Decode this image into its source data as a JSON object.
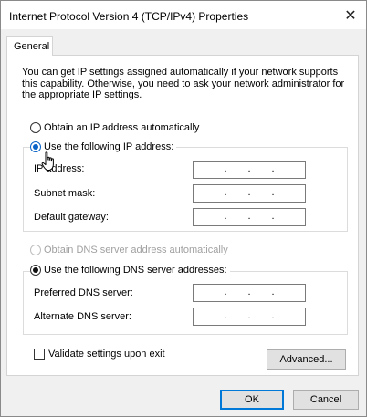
{
  "window": {
    "title": "Internet Protocol Version 4 (TCP/IPv4) Properties",
    "close_glyph": "✕"
  },
  "tabs": [
    {
      "label": "General",
      "selected": true
    }
  ],
  "description": "You can get IP settings assigned automatically if your network supports this capability. Otherwise, you need to ask your network administrator for the appropriate IP settings.",
  "ip_settings": {
    "auto_option": {
      "label": "Obtain an IP address automatically",
      "checked": false
    },
    "manual_option": {
      "label": "Use the following IP address:",
      "checked": true
    },
    "fields": [
      {
        "label": "IP address:",
        "value": ""
      },
      {
        "label": "Subnet mask:",
        "value": ""
      },
      {
        "label": "Default gateway:",
        "value": ""
      }
    ]
  },
  "dns_settings": {
    "auto_option": {
      "label": "Obtain DNS server address automatically",
      "checked": false,
      "disabled": true
    },
    "manual_option": {
      "label": "Use the following DNS server addresses:",
      "checked": true
    },
    "fields": [
      {
        "label": "Preferred DNS server:",
        "value": ""
      },
      {
        "label": "Alternate DNS server:",
        "value": ""
      }
    ]
  },
  "validate": {
    "label": "Validate settings upon exit",
    "checked": false
  },
  "buttons": {
    "advanced": "Advanced...",
    "ok": "OK",
    "cancel": "Cancel"
  },
  "ip_dot": "."
}
